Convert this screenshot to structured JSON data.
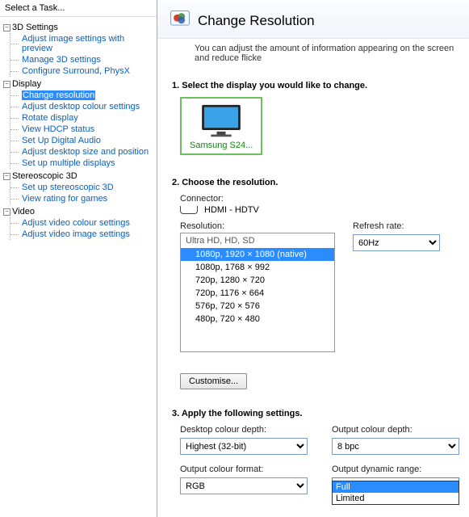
{
  "sidebar": {
    "header": "Select a Task...",
    "categories": [
      {
        "label": "3D Settings",
        "expanded": true,
        "items": [
          "Adjust image settings with preview",
          "Manage 3D settings",
          "Configure Surround, PhysX"
        ]
      },
      {
        "label": "Display",
        "expanded": true,
        "items": [
          "Change resolution",
          "Adjust desktop colour settings",
          "Rotate display",
          "View HDCP status",
          "Set Up Digital Audio",
          "Adjust desktop size and position",
          "Set up multiple displays"
        ],
        "selectedIndex": 0
      },
      {
        "label": "Stereoscopic 3D",
        "expanded": true,
        "items": [
          "Set up stereoscopic 3D",
          "View rating for games"
        ]
      },
      {
        "label": "Video",
        "expanded": true,
        "items": [
          "Adjust video colour settings",
          "Adjust video image settings"
        ]
      }
    ]
  },
  "page": {
    "title": "Change Resolution",
    "subtitle": "You can adjust the amount of information appearing on the screen and reduce flicke"
  },
  "section1": {
    "heading": "1. Select the display you would like to change.",
    "displayName": "Samsung S24..."
  },
  "section2": {
    "heading": "2. Choose the resolution.",
    "connectorLabel": "Connector:",
    "connectorValue": "HDMI - HDTV",
    "resolutionLabel": "Resolution:",
    "resGroupLabel": "Ultra HD, HD, SD",
    "resOptions": [
      "1080p, 1920 × 1080 (native)",
      "1080p, 1768 × 992",
      "720p, 1280 × 720",
      "720p, 1176 × 664",
      "576p, 720 × 576",
      "480p, 720 × 480"
    ],
    "resSelectedIndex": 0,
    "refreshLabel": "Refresh rate:",
    "refreshValue": "60Hz",
    "customiseLabel": "Customise..."
  },
  "section3": {
    "heading": "3. Apply the following settings.",
    "desktopDepthLabel": "Desktop colour depth:",
    "desktopDepthValue": "Highest (32-bit)",
    "outputDepthLabel": "Output colour depth:",
    "outputDepthValue": "8 bpc",
    "outputFormatLabel": "Output colour format:",
    "outputFormatValue": "RGB",
    "dynamicRangeLabel": "Output dynamic range:",
    "dynamicRangeValue": "Limited",
    "dynamicRangeOptions": [
      "Full",
      "Limited"
    ]
  }
}
